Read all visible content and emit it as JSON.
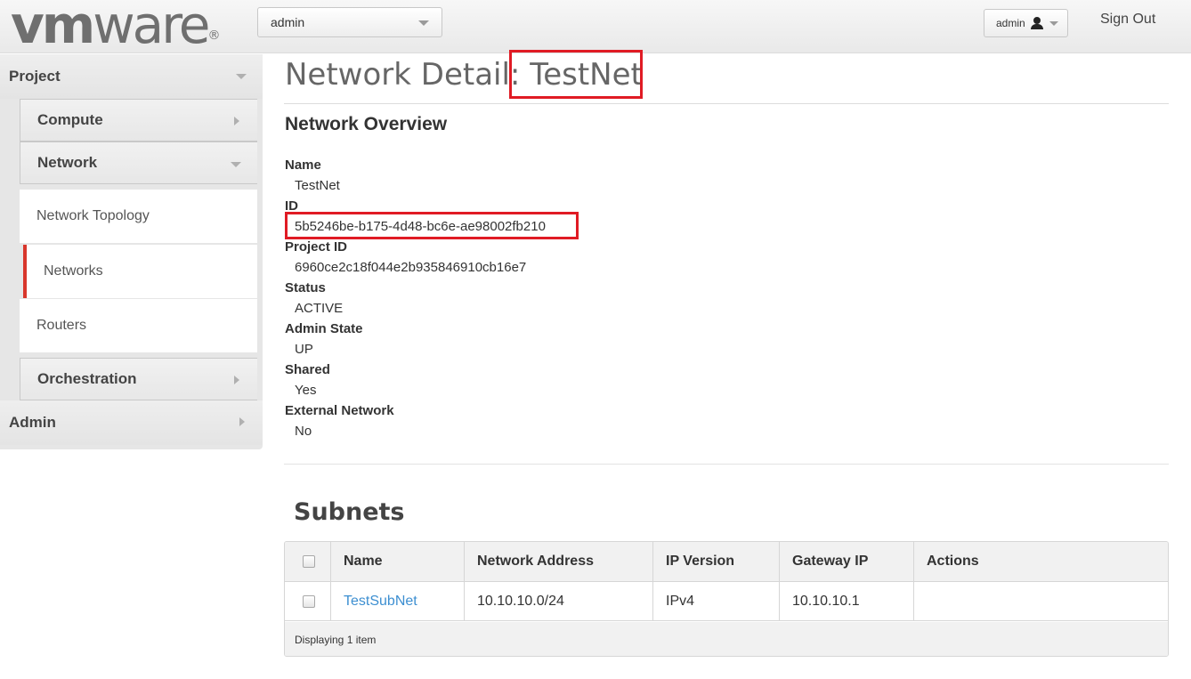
{
  "brand": {
    "logo_bold": "vm",
    "logo_rest": "ware",
    "logo_mark": "®"
  },
  "header": {
    "project_selector": "admin",
    "user_menu": "admin",
    "sign_out": "Sign Out"
  },
  "sidebar": {
    "project": "Project",
    "compute": "Compute",
    "network": "Network",
    "links": [
      "Network Topology",
      "Networks",
      "Routers"
    ],
    "active_link": "Networks",
    "orchestration": "Orchestration",
    "admin": "Admin"
  },
  "page": {
    "title_prefix": "Network Detail:",
    "title_name": "TestNet",
    "overview_heading": "Network Overview",
    "fields": [
      {
        "label": "Name",
        "value": "TestNet"
      },
      {
        "label": "ID",
        "value": "5b5246be-b175-4d48-bc6e-ae98002fb210"
      },
      {
        "label": "Project ID",
        "value": "6960ce2c18f044e2b935846910cb16e7"
      },
      {
        "label": "Status",
        "value": "ACTIVE"
      },
      {
        "label": "Admin State",
        "value": "UP"
      },
      {
        "label": "Shared",
        "value": "Yes"
      },
      {
        "label": "External Network",
        "value": "No"
      }
    ],
    "highlight_color": "#e01b24"
  },
  "subnets": {
    "heading": "Subnets",
    "columns": [
      "Name",
      "Network Address",
      "IP Version",
      "Gateway IP",
      "Actions"
    ],
    "rows": [
      {
        "name": "TestSubNet",
        "network_address": "10.10.10.0/24",
        "ip_version": "IPv4",
        "gateway_ip": "10.10.10.1",
        "actions": ""
      }
    ],
    "footer": "Displaying 1 item"
  }
}
